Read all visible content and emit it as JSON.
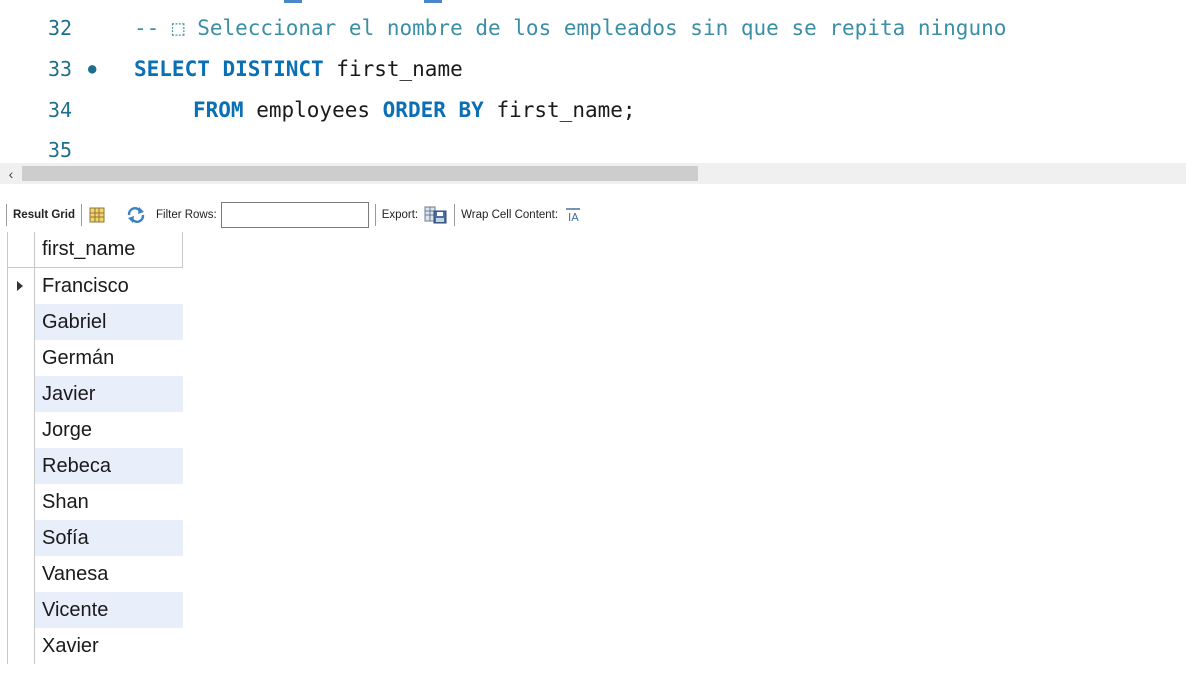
{
  "editor": {
    "lines": [
      {
        "num": "32",
        "dot": false,
        "comment": "-- ⬚ Seleccionar el nombre de los empleados sin que se repita ninguno"
      },
      {
        "num": "33",
        "dot": true,
        "kw1": "SELECT DISTINCT",
        "rest1": " first_name"
      },
      {
        "num": "34",
        "dot": false,
        "kw1": "FROM",
        "rest1": " employees ",
        "kw2": "ORDER BY",
        "rest2": " first_name;"
      },
      {
        "num": "35",
        "dot": false
      }
    ]
  },
  "toolbar": {
    "result_grid_label": "Result Grid",
    "filter_label": "Filter Rows:",
    "filter_value": "",
    "export_label": "Export:",
    "wrap_label": "Wrap Cell Content:"
  },
  "grid": {
    "column": "first_name",
    "rows": [
      "Francisco",
      "Gabriel",
      "Germán",
      "Javier",
      "Jorge",
      "Rebeca",
      "Shan",
      "Sofía",
      "Vanesa",
      "Vicente",
      "Xavier"
    ],
    "selected_row": 0
  },
  "colors": {
    "keyword": "#0b6fb4",
    "comment": "#3a8fa6",
    "line_number": "#1f6e8c",
    "alt_row": "#e8effa"
  },
  "icons": {
    "scroll_left": "chevron-left-icon",
    "grid_form": "grid-layout-icon",
    "refresh": "refresh-icon",
    "export": "export-save-icon",
    "wrap": "wrap-text-icon",
    "row_pointer": "row-pointer-icon"
  }
}
